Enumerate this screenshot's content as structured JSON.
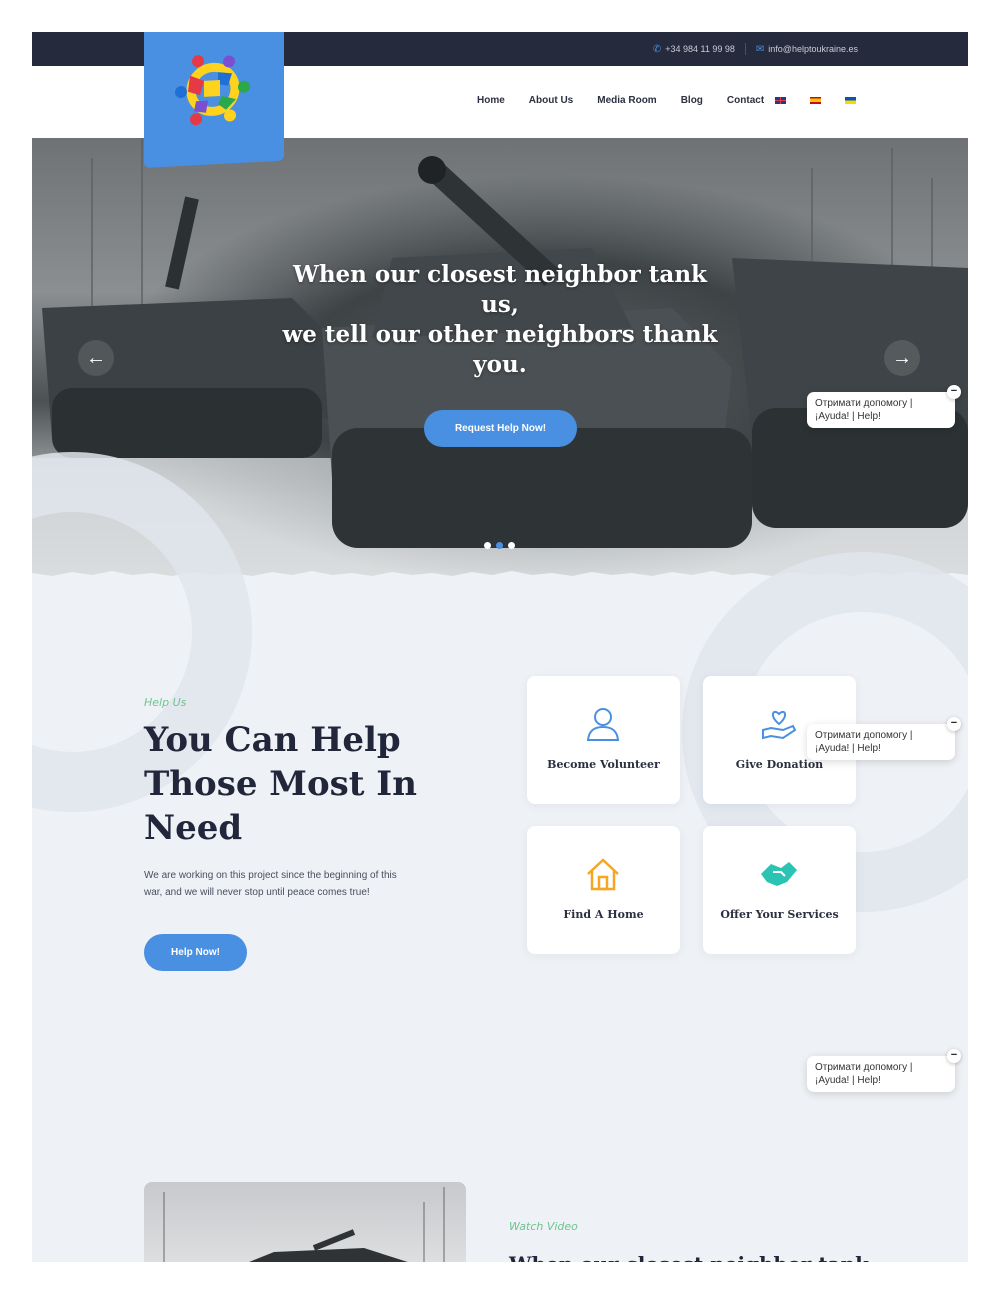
{
  "topbar": {
    "phone": "+34 984 11 99 98",
    "email": "info@helptoukraine.es"
  },
  "nav": {
    "items": [
      "Home",
      "About Us",
      "Media Room",
      "Blog",
      "Contact"
    ],
    "flags": [
      "flag-uk-icon",
      "flag-es-icon",
      "flag-ua-icon"
    ]
  },
  "hero": {
    "title": "When our closest neighbor tank us,\nwe tell our other neighbors thank you.",
    "button": "Request Help Now!",
    "arrow_left": "←",
    "arrow_right": "→",
    "slides": 3,
    "active_slide": 2
  },
  "help": {
    "eyebrow": "Help Us",
    "title": "You Can Help Those Most In Need",
    "description": "We are working on this project since the beginning of this war, and we will never stop until peace comes true!",
    "button": "Help Now!",
    "cards": [
      {
        "label": "Become Volunteer",
        "icon": "user-icon"
      },
      {
        "label": "Give Donation",
        "icon": "heart-hand-icon"
      },
      {
        "label": "Find A Home",
        "icon": "home-icon"
      },
      {
        "label": "Offer Your Services",
        "icon": "handshake-icon"
      }
    ]
  },
  "chat_widget": {
    "text": "Отримати допомогу | ¡Ayuda! | Help!",
    "close": "−"
  },
  "video": {
    "eyebrow": "Watch Video",
    "heading": "When our closest neighbor tank"
  },
  "colors": {
    "accent": "#4a90e2",
    "topbar": "#262a3d",
    "eyebrow": "#6ec48f",
    "heading": "#22263a"
  }
}
